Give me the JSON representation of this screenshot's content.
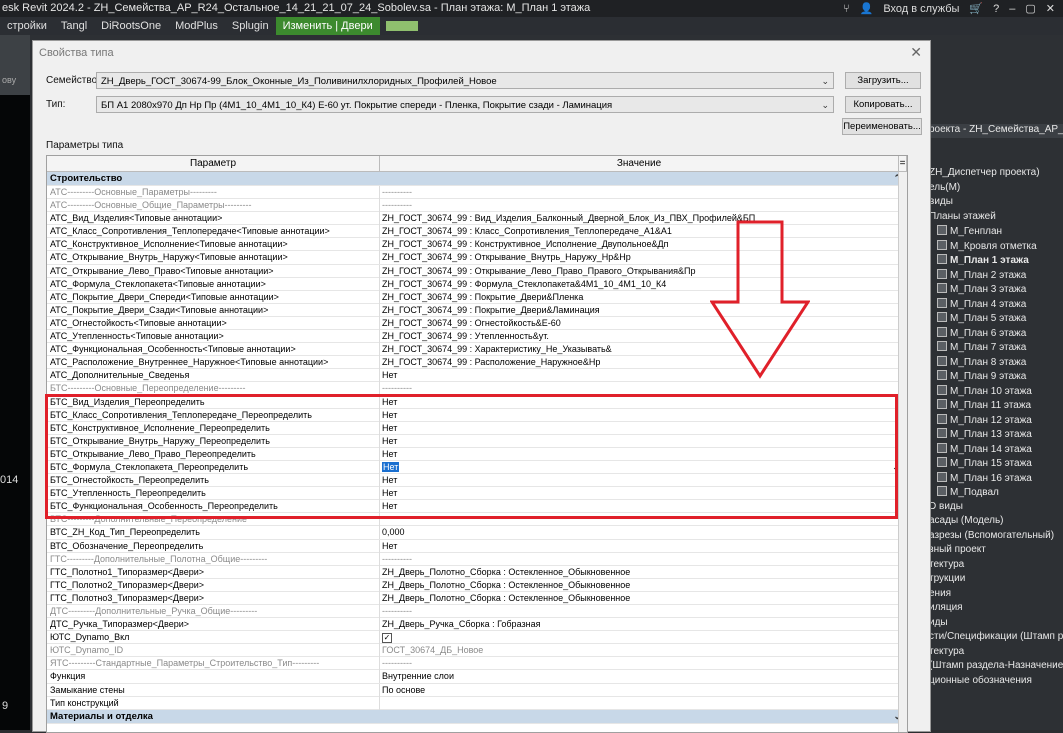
{
  "app": {
    "title": "esk Revit 2024.2 - ZH_Семейства_АР_R24_Остальное_14_21_21_07_24_Sobolev.sa - План этажа: М_План 1 этажа",
    "signin": "Вход в службы"
  },
  "ribbon_tabs": [
    "стройки",
    "Tangl",
    "DiRootsOne",
    "ModPlus",
    "Splugin",
    "Изменить | Двери"
  ],
  "left_labels": [
    "ову",
    "014",
    "9"
  ],
  "right_panel": {
    "header": "роекта - ZH_Семейства_АР_R24_...",
    "items": [
      "ZH_Диспетчер проекта)",
      "ель(М)",
      "виды",
      "Планы этажей",
      "М_Генплан",
      "М_Кровля отметка",
      "М_План 1 этажа",
      "М_План 2 этажа",
      "М_План 3 этажа",
      "М_План 4 этажа",
      "М_План 5 этажа",
      "М_План 6 этажа",
      "М_План 7 этажа",
      "М_План 8 этажа",
      "М_План 9 этажа",
      "М_План 10 этажа",
      "М_План 11 этажа",
      "М_План 12 этажа",
      "М_План 13 этажа",
      "М_План 14 этажа",
      "М_План 15 этажа",
      "М_План 16 этажа",
      "М_Подвал",
      "D виды",
      "асады (Модель)",
      "азрезы (Вспомогательный)",
      "зный проект",
      "тектура",
      "трукции",
      "ения",
      "иляция",
      "иды",
      "сти/Спецификации (Штамп р",
      "тектура",
      "(Штамп раздела-Назначение",
      "ционные обозначения"
    ]
  },
  "dialog": {
    "title": "Свойства типа",
    "family_label": "Семейство:",
    "family_value": "ZH_Дверь_ГОСТ_30674-99_Блок_Оконные_Из_Поливинилхлоридных_Профилей_Новое",
    "type_label": "Тип:",
    "type_value": "БП А1 2080х970 Дп Нр Пр (4М1_10_4М1_10_К4) Е-60 ут.  Покрытие спереди - Пленка, Покрытие сзади - Ламинация",
    "load_btn": "Загрузить...",
    "copy_btn": "Копировать...",
    "rename_btn": "Переименовать...",
    "params_label": "Параметры типа",
    "col_param": "Параметр",
    "col_value": "Значение"
  },
  "rows": [
    {
      "p": "Строительство",
      "v": "",
      "kind": "group"
    },
    {
      "p": "АТС---------Основные_Параметры---------",
      "v": "----------",
      "kind": "gray"
    },
    {
      "p": "АТС---------Основные_Общие_Параметры---------",
      "v": "----------",
      "kind": "gray"
    },
    {
      "p": "АТС_Вид_Изделия<Типовые аннотации>",
      "v": "ZH_ГОСТ_30674_99 : Вид_Изделия_Балконный_Дверной_Блок_Из_ПВХ_Профилей&БП"
    },
    {
      "p": "АТС_Класс_Сопротивления_Теплопередаче<Типовые аннотации>",
      "v": "ZH_ГОСТ_30674_99 : Класс_Сопротивления_Теплопередаче_А1&А1"
    },
    {
      "p": "АТС_Конструктивное_Исполнение<Типовые аннотации>",
      "v": "ZH_ГОСТ_30674_99 : Конструктивное_Исполнение_Двупольное&Дп"
    },
    {
      "p": "АТС_Открывание_Внутрь_Наружу<Типовые аннотации>",
      "v": "ZH_ГОСТ_30674_99 : Открывание_Внутрь_Наружу_Нр&Нр"
    },
    {
      "p": "АТС_Открывание_Лево_Право<Типовые аннотации>",
      "v": "ZH_ГОСТ_30674_99 : Открывание_Лево_Право_Правого_Открывания&Пр"
    },
    {
      "p": "АТС_Формула_Стеклопакета<Типовые аннотации>",
      "v": "ZH_ГОСТ_30674_99 : Формула_Стеклопакета&4М1_10_4М1_10_К4"
    },
    {
      "p": "АТС_Покрытие_Двери_Спереди<Типовые аннотации>",
      "v": "ZH_ГОСТ_30674_99 : Покрытие_Двери&Пленка"
    },
    {
      "p": "АТС_Покрытие_Двери_Сзади<Типовые аннотации>",
      "v": "ZH_ГОСТ_30674_99 : Покрытие_Двери&Ламинация"
    },
    {
      "p": "АТС_Огнестойкость<Типовые аннотации>",
      "v": "ZH_ГОСТ_30674_99 : Огнестойкость&Е-60"
    },
    {
      "p": "АТС_Утепленность<Типовые аннотации>",
      "v": "ZH_ГОСТ_30674_99 : Утепленность&ут."
    },
    {
      "p": "АТС_Функциональная_Особенность<Типовые аннотации>",
      "v": "ZH_ГОСТ_30674_99 : Характеристику_Не_Указывать&"
    },
    {
      "p": "АТС_Расположение_Внутреннее_Наружное<Типовые аннотации>",
      "v": "ZH_ГОСТ_30674_99 : Расположение_Наружное&Нр"
    },
    {
      "p": "АТС_Дополнительные_Сведенья",
      "v": "Нет"
    },
    {
      "p": "БТС---------Основные_Переопределение---------",
      "v": "----------",
      "kind": "gray"
    },
    {
      "p": "БТС_Вид_Изделия_Переопределить",
      "v": "Нет"
    },
    {
      "p": "БТС_Класс_Сопротивления_Теплопередаче_Переопределить",
      "v": "Нет"
    },
    {
      "p": "БТС_Конструктивное_Исполнение_Переопределить",
      "v": "Нет"
    },
    {
      "p": "БТС_Открывание_Внутрь_Наружу_Переопределить",
      "v": "Нет"
    },
    {
      "p": "БТС_Открывание_Лево_Право_Переопределить",
      "v": "Нет"
    },
    {
      "p": "БТС_Формула_Стеклопакета_Переопределить",
      "v": "Нет",
      "kind": "selected"
    },
    {
      "p": "БТС_Огнестойкость_Переопределить",
      "v": "Нет"
    },
    {
      "p": "БТС_Утепленность_Переопределить",
      "v": "Нет"
    },
    {
      "p": "БТС_Функциональная_Особенность_Переопределить",
      "v": "Нет"
    },
    {
      "p": "ВТС---------Дополнительные_Переопределение",
      "v": "",
      "kind": "gray"
    },
    {
      "p": "ВТС_ZH_Код_Тип_Переопределить",
      "v": "0,000"
    },
    {
      "p": "ВТС_Обозначение_Переопределить",
      "v": "Нет"
    },
    {
      "p": "ГТС---------Дополнительные_Полотна_Общие---------",
      "v": "----------",
      "kind": "gray"
    },
    {
      "p": "ГТС_Полотно1_Типоразмер<Двери>",
      "v": "ZH_Дверь_Полотно_Сборка : Остекленное_Обыкновенное"
    },
    {
      "p": "ГТС_Полотно2_Типоразмер<Двери>",
      "v": "ZH_Дверь_Полотно_Сборка : Остекленное_Обыкновенное"
    },
    {
      "p": "ГТС_Полотно3_Типоразмер<Двери>",
      "v": "ZH_Дверь_Полотно_Сборка : Остекленное_Обыкновенное"
    },
    {
      "p": "ДТС---------Дополнительные_Ручка_Общие---------",
      "v": "----------",
      "kind": "gray"
    },
    {
      "p": "ДТС_Ручка_Типоразмер<Двери>",
      "v": "ZH_Дверь_Ручка_Сборка : Гобразная"
    },
    {
      "p": "ЮТС_Dynamo_Вкл",
      "v": "",
      "kind": "check"
    },
    {
      "p": "ЮТС_Dynamo_ID",
      "v": "ГОСТ_30674_ДБ_Новое",
      "kind": "gray"
    },
    {
      "p": "ЯТС---------Стандартные_Параметры_Строительство_Тип---------",
      "v": "----------",
      "kind": "gray"
    },
    {
      "p": "Функция",
      "v": "Внутренние слои"
    },
    {
      "p": "Замыкание стены",
      "v": "По основе"
    },
    {
      "p": "Тип конструкций",
      "v": ""
    },
    {
      "p": "Материалы и отделка",
      "v": "",
      "kind": "group2"
    }
  ]
}
